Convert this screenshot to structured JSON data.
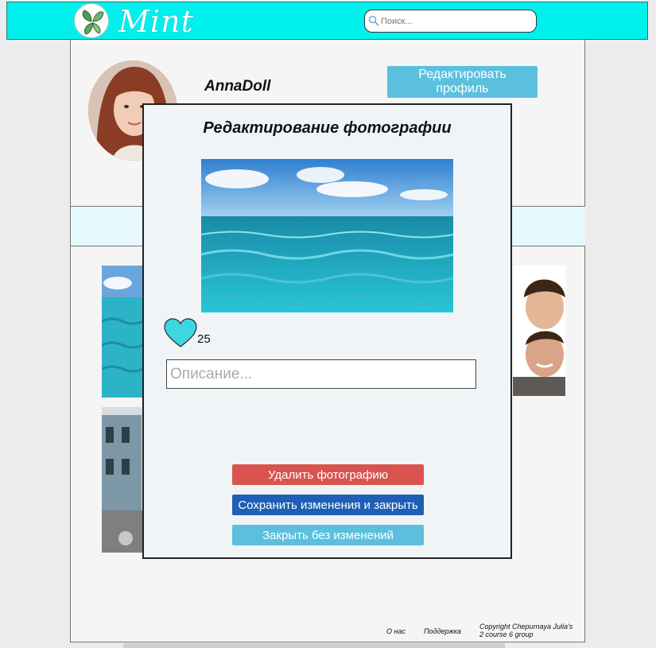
{
  "header": {
    "logo_text": "Mint",
    "search_placeholder": "Поиск..."
  },
  "profile": {
    "username": "AnnaDoll",
    "edit_button": "Редактировать профиль"
  },
  "modal": {
    "title": "Редактирование фотографии",
    "likes": "25",
    "description_placeholder": "Описание...",
    "delete_button": "Удалить фотографию",
    "save_button": "Сохранить изменения и закрыть",
    "close_button": "Закрыть без изменений"
  },
  "footer": {
    "about": "О нас",
    "support": "Поддержка",
    "copyright_line1": "Copyright Chepurnaya Julia's",
    "copyright_line2": "2 course  6 group"
  },
  "colors": {
    "header_bg": "#00f0ee",
    "delete": "#d9534f",
    "save": "#1f5fb5",
    "info": "#5bc0de",
    "heart": "#3fd6e0"
  }
}
